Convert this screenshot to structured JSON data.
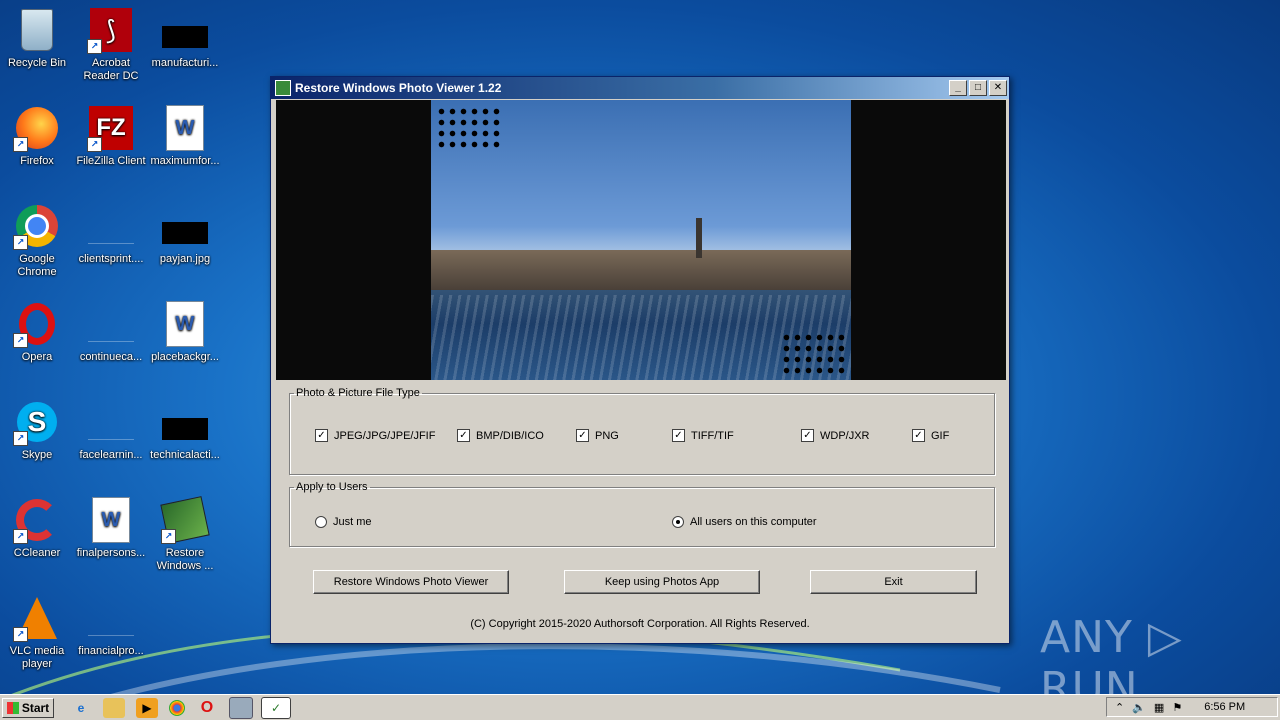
{
  "desktop": {
    "icons": [
      {
        "label": "Recycle Bin",
        "icon": "recycle-bin-icon"
      },
      {
        "label": "Acrobat Reader DC",
        "icon": "acrobat-icon"
      },
      {
        "label": "manufacturi...",
        "icon": "redacted-file-icon"
      },
      {
        "label": "Firefox",
        "icon": "firefox-icon"
      },
      {
        "label": "FileZilla Client",
        "icon": "filezilla-icon"
      },
      {
        "label": "maximumfor...",
        "icon": "word-doc-icon"
      },
      {
        "label": "Google Chrome",
        "icon": "chrome-icon"
      },
      {
        "label": "clientsprint....",
        "icon": "blank-file-icon"
      },
      {
        "label": "payjan.jpg",
        "icon": "redacted-file-icon"
      },
      {
        "label": "Opera",
        "icon": "opera-icon"
      },
      {
        "label": "continueca...",
        "icon": "blank-file-icon"
      },
      {
        "label": "placebackgr...",
        "icon": "word-doc-icon"
      },
      {
        "label": "Skype",
        "icon": "skype-icon"
      },
      {
        "label": "facelearnin...",
        "icon": "blank-file-icon"
      },
      {
        "label": "technicalacti...",
        "icon": "redacted-file-icon"
      },
      {
        "label": "CCleaner",
        "icon": "ccleaner-icon"
      },
      {
        "label": "finalpersons...",
        "icon": "word-doc-icon"
      },
      {
        "label": "Restore Windows ...",
        "icon": "restore-photo-viewer-icon"
      },
      {
        "label": "VLC media player",
        "icon": "vlc-icon"
      },
      {
        "label": "financialpro...",
        "icon": "blank-file-icon"
      }
    ]
  },
  "window": {
    "title": "Restore Windows Photo Viewer 1.22",
    "controls": {
      "minimize": "_",
      "maximize": "□",
      "close": "✕"
    },
    "file_types": {
      "legend": "Photo & Picture File Type",
      "items": [
        {
          "label": "JPEG/JPG/JPE/JFIF",
          "checked": true
        },
        {
          "label": "BMP/DIB/ICO",
          "checked": true
        },
        {
          "label": "PNG",
          "checked": true
        },
        {
          "label": "TIFF/TIF",
          "checked": true
        },
        {
          "label": "WDP/JXR",
          "checked": true
        },
        {
          "label": "GIF",
          "checked": true
        }
      ]
    },
    "users": {
      "legend": "Apply to Users",
      "options": [
        {
          "label": "Just me",
          "selected": false
        },
        {
          "label": "All users on this computer",
          "selected": true
        }
      ]
    },
    "buttons": {
      "restore": "Restore Windows Photo Viewer",
      "keep": "Keep using Photos App",
      "exit": "Exit"
    },
    "copyright": "(C) Copyright 2015-2020 Authorsoft Corporation. All Rights Reserved."
  },
  "watermark": "ANY ▷ RUN",
  "taskbar": {
    "start_label": "Start",
    "check_mark": "✓",
    "clock": "6:56 PM"
  }
}
